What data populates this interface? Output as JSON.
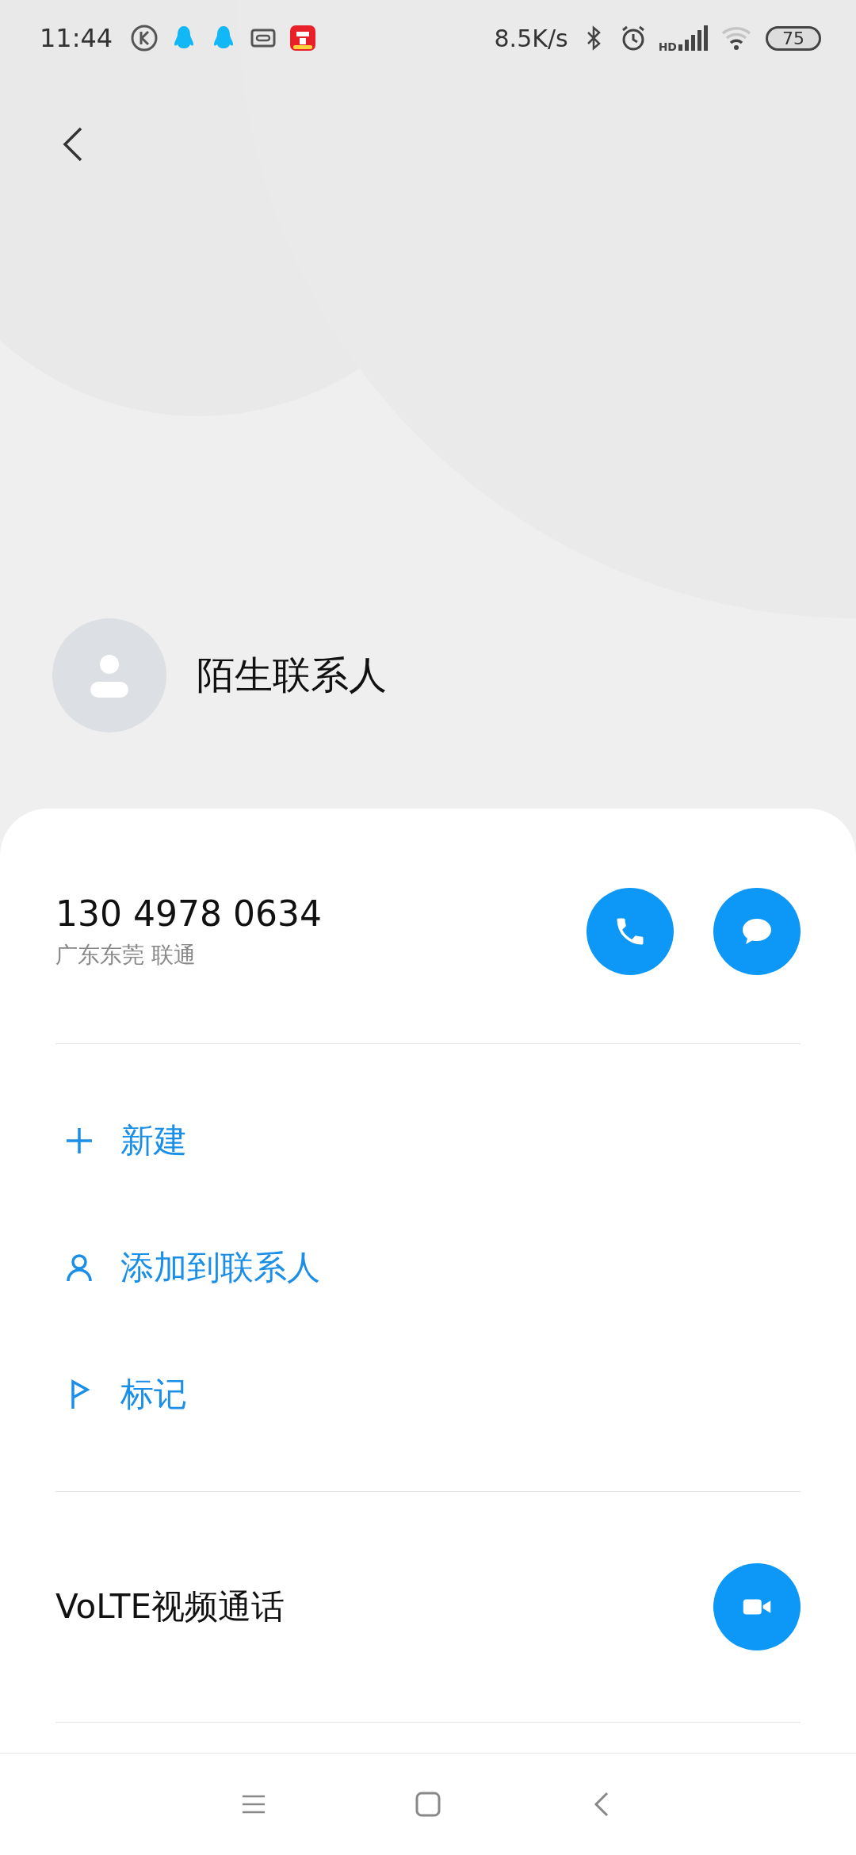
{
  "status_bar": {
    "time": "11:44",
    "net_speed": "8.5K/s",
    "signal_label": "HD",
    "battery": "75"
  },
  "contact": {
    "name": "陌生联系人"
  },
  "number": {
    "value": "130 4978 0634",
    "location": "广东东莞 联通"
  },
  "actions": [
    {
      "kind": "new",
      "label": "新建"
    },
    {
      "kind": "add_contact",
      "label": "添加到联系人"
    },
    {
      "kind": "mark",
      "label": "标记"
    }
  ],
  "video_call": {
    "label": "VoLTE视频通话"
  }
}
